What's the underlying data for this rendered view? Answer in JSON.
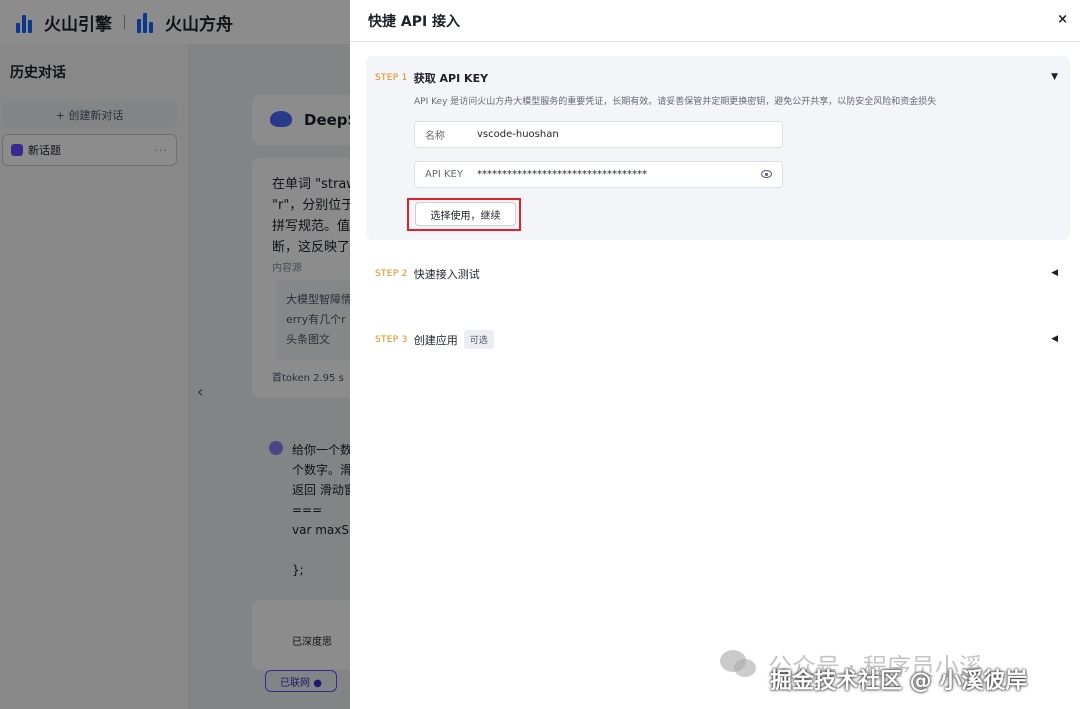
{
  "brand": {
    "name1": "火山引擎",
    "name2": "火山方舟"
  },
  "sidebar": {
    "title": "历史对话",
    "new_chat": "+ 创建新对话",
    "topics": [
      {
        "label": "新话题",
        "more": "···"
      }
    ]
  },
  "background": {
    "model_name": "DeepS",
    "answer_lines": [
      "在单词 \"straw",
      "\"r\"，分别位于",
      "拼写规范。值",
      "断，这反映了"
    ],
    "source_label": "内容源",
    "source_card_lines": [
      "大模型智障情",
      "erry有几个r",
      "头条图文"
    ],
    "token_text": "首token 2.95 s",
    "question_lines": [
      "给你一个数",
      "个数字。滑",
      "返回 滑动窗",
      "===",
      "var maxSl",
      "",
      "};"
    ],
    "deep_thought": "已深度思",
    "net_button": "已联网 ●"
  },
  "drawer": {
    "title": "快捷 API 接入",
    "close": "×",
    "steps": [
      {
        "tag": "STEP 1",
        "title": "获取 API KEY",
        "caret": "▼",
        "description": "API Key 是访问火山方舟大模型服务的重要凭证，长期有效。请妥善保管并定期更换密钥，避免公开共享，以防安全风险和资金损失",
        "fields": [
          {
            "label": "名称",
            "value": "vscode-huoshan"
          },
          {
            "label": "API KEY",
            "value": "**********************************"
          }
        ],
        "button": "选择使用，继续"
      },
      {
        "tag": "STEP 2",
        "title": "快速接入测试",
        "caret": "◀"
      },
      {
        "tag": "STEP 3",
        "title": "创建应用",
        "badge": "可选",
        "caret": "◀"
      }
    ]
  },
  "watermark": {
    "line1": "公众号 · 程序员小溪",
    "line2": "掘金技术社区 @ 小溪彼岸"
  },
  "colors": {
    "accent": "#1664ff",
    "step": "#e08a12",
    "highlight": "#e0202c"
  }
}
